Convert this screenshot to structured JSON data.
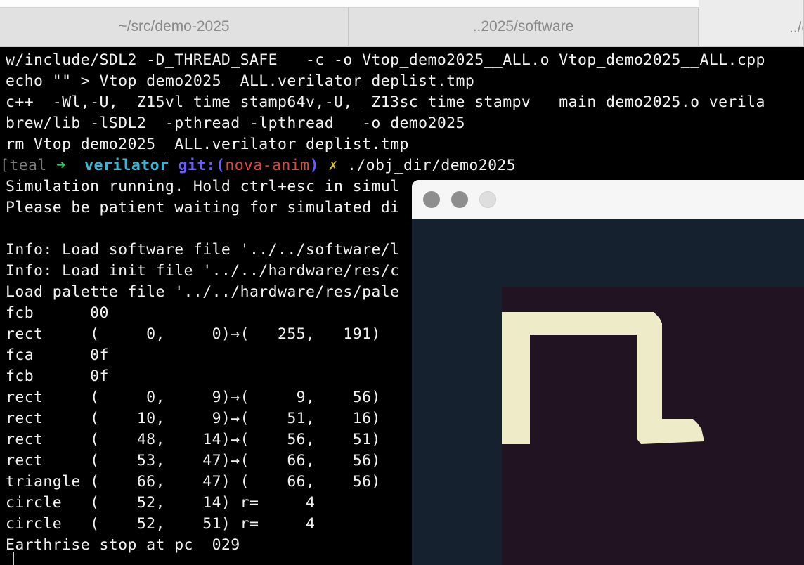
{
  "tabs": [
    {
      "label": "~/src/demo-2025"
    },
    {
      "label": "..2025/software"
    },
    {
      "label": "../c"
    }
  ],
  "terminal": {
    "lines": [
      "w/include/SDL2 -D_THREAD_SAFE   -c -o Vtop_demo2025__ALL.o Vtop_demo2025__ALL.cpp",
      "echo \"\" > Vtop_demo2025__ALL.verilator_deplist.tmp",
      "c++  -Wl,-U,__Z15vl_time_stamp64v,-U,__Z13sc_time_stampv   main_demo2025.o verila",
      "brew/lib -lSDL2  -pthread -lpthread   -o demo2025",
      "rm Vtop_demo2025__ALL.verilator_deplist.tmp"
    ],
    "prompt": {
      "bracket": "[teal",
      "arrow": "➜",
      "dir": "verilator",
      "git_label": "git:(",
      "branch": "nova-anim",
      "git_close": ")",
      "dirty_mark": "✗",
      "command": "./obj_dir/demo2025"
    },
    "output": [
      "Simulation running. Hold ctrl+esc in simul",
      "Please be patient waiting for simulated di",
      "",
      "Info: Load software file '../../software/l",
      "Info: Load init file '../../hardware/res/c",
      "Load palette file '../../hardware/res/pale",
      "fcb      00",
      "rect     (     0,     0)→(   255,   191)",
      "fca      0f",
      "fcb      0f",
      "rect     (     0,     9)→(     9,    56)",
      "rect     (    10,     9)→(    51,    16)",
      "rect     (    48,    14)→(    56,    51)",
      "rect     (    53,    47)→(    66,    56)",
      "triangle (    66,    47) (    66,    56)",
      "circle   (    52,    14) r=     4",
      "circle   (    52,    51) r=     4",
      "Earthrise stop at pc  029"
    ]
  },
  "emulator": {
    "background_color": "#15212e",
    "fill_color": "#221322",
    "shape_color": "#eeebc9"
  }
}
